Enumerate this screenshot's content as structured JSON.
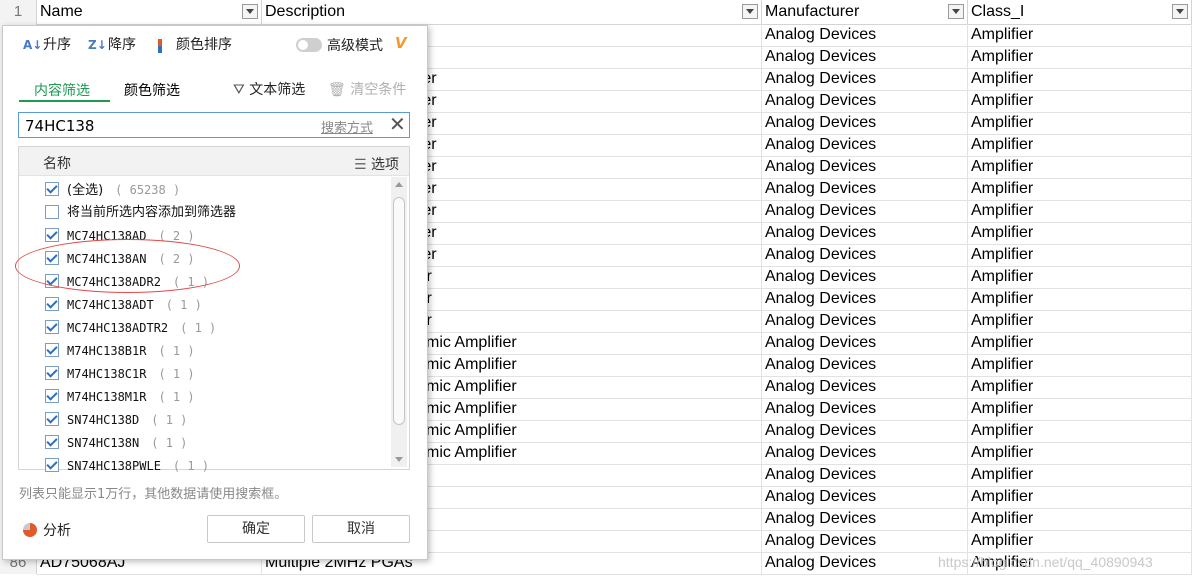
{
  "header": {
    "row_number": "1",
    "columns": [
      "Name",
      "Description",
      "Manufacturer",
      "Class_I"
    ]
  },
  "rows": [
    {
      "desc": "tion Amplifier",
      "man": "Analog Devices",
      "cls": "Amplifier"
    },
    {
      "desc": "tion Amplifier",
      "man": "Analog Devices",
      "cls": "Amplifier"
    },
    {
      "desc": "nstrumentation Amplifier",
      "man": "Analog Devices",
      "cls": "Amplifier"
    },
    {
      "desc": "nstrumentation Amplifier",
      "man": "Analog Devices",
      "cls": "Amplifier"
    },
    {
      "desc": "nstrumentation Amplifier",
      "man": "Analog Devices",
      "cls": "Amplifier"
    },
    {
      "desc": "nstrumentation Amplifier",
      "man": "Analog Devices",
      "cls": "Amplifier"
    },
    {
      "desc": "nstrumentation Amplifier",
      "man": "Analog Devices",
      "cls": "Amplifier"
    },
    {
      "desc": "nstrumentation Amplifier",
      "man": "Analog Devices",
      "cls": "Amplifier"
    },
    {
      "desc": "nstrumentation Amplifier",
      "man": "Analog Devices",
      "cls": "Amplifier"
    },
    {
      "desc": "nstrumentation Amplifier",
      "man": "Analog Devices",
      "cls": "Amplifier"
    },
    {
      "desc": "nstrumentation Amplifier",
      "man": "Analog Devices",
      "cls": "Amplifier"
    },
    {
      "desc": "ply Differential Amplifier",
      "man": "Analog Devices",
      "cls": "Amplifier"
    },
    {
      "desc": "ply Differential Amplifier",
      "man": "Analog Devices",
      "cls": "Amplifier"
    },
    {
      "desc": "ply Differential Amplifier",
      "man": "Analog Devices",
      "cls": "Amplifier"
    },
    {
      "desc": "ating 120MHz Logarithmic Amplifier",
      "man": "Analog Devices",
      "cls": "Amplifier"
    },
    {
      "desc": "ating 120MHz Logarithmic Amplifier",
      "man": "Analog Devices",
      "cls": "Amplifier"
    },
    {
      "desc": "ating 120MHz Logarithmic Amplifier",
      "man": "Analog Devices",
      "cls": "Amplifier"
    },
    {
      "desc": "ating 120MHz Logarithmic Amplifier",
      "man": "Analog Devices",
      "cls": "Amplifier"
    },
    {
      "desc": "ating 120MHz Logarithmic Amplifier",
      "man": "Analog Devices",
      "cls": "Amplifier"
    },
    {
      "desc": "ating 120MHz Logarithmic Amplifier",
      "man": "Analog Devices",
      "cls": "Amplifier"
    },
    {
      "desc": ") Logarithmic Amplifier",
      "man": "Analog Devices",
      "cls": "Amplifier"
    },
    {
      "desc": ") Logarithmic Amplifier",
      "man": "Analog Devices",
      "cls": "Amplifier"
    },
    {
      "desc": ") Logarithmic Amplifier",
      "man": "Analog Devices",
      "cls": "Amplifier"
    },
    {
      "desc": "",
      "man": "Analog Devices",
      "cls": "Amplifier"
    },
    {
      "num": "86",
      "name": "AD75068AJ",
      "desc": "Multiple 2MHz PGAs",
      "man": "Analog Devices",
      "cls": "Amplifier"
    }
  ],
  "filter_panel": {
    "sort_asc": "升序",
    "sort_desc": "降序",
    "color_sort": "颜色排序",
    "advanced_mode": "高级模式",
    "advanced_badge": "V",
    "tab_content": "内容筛选",
    "tab_color": "颜色筛选",
    "text_filter": "文本筛选",
    "clear_conditions": "清空条件",
    "search_value": "74HC138",
    "search_mode": "搜索方式",
    "list_header_name": "名称",
    "list_header_options": "选项",
    "items": [
      {
        "label": "(全选)",
        "count": "( 65238 )",
        "checked": true
      },
      {
        "label": "将当前所选内容添加到筛选器",
        "count": "",
        "checked": false
      },
      {
        "label": "MC74HC138AD",
        "count": "( 2 )",
        "checked": true
      },
      {
        "label": "MC74HC138AN",
        "count": "( 2 )",
        "checked": true
      },
      {
        "label": "MC74HC138ADR2",
        "count": "( 1 )",
        "checked": true
      },
      {
        "label": "MC74HC138ADT",
        "count": "( 1 )",
        "checked": true
      },
      {
        "label": "MC74HC138ADTR2",
        "count": "( 1 )",
        "checked": true
      },
      {
        "label": "M74HC138B1R",
        "count": "( 1 )",
        "checked": true
      },
      {
        "label": "M74HC138C1R",
        "count": "( 1 )",
        "checked": true
      },
      {
        "label": "M74HC138M1R",
        "count": "( 1 )",
        "checked": true
      },
      {
        "label": "SN74HC138D",
        "count": "( 1 )",
        "checked": true
      },
      {
        "label": "SN74HC138N",
        "count": "( 1 )",
        "checked": true
      },
      {
        "label": "SN74HC138PWLE",
        "count": "( 1 )",
        "checked": true
      }
    ],
    "note": "列表只能显示1万行，其他数据请使用搜索框。",
    "analyze": "分析",
    "ok": "确定",
    "cancel": "取消"
  },
  "watermark": "https://blog.csdn.net/qq_40890943"
}
